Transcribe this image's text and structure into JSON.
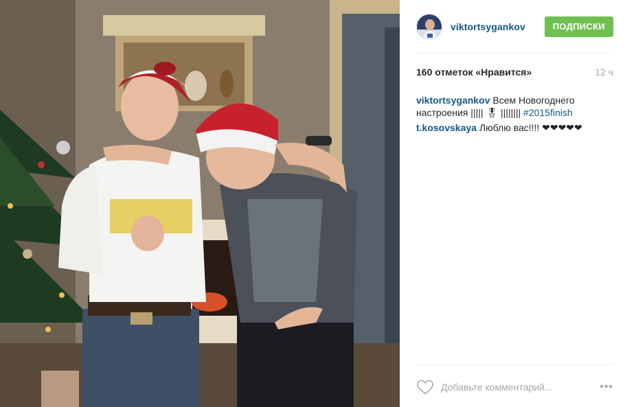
{
  "header": {
    "username": "viktortsygankov",
    "follow_label": "ПОДПИСКИ"
  },
  "meta": {
    "likes": "160 отметок «Нравится»",
    "time": "12 ч"
  },
  "comments": [
    {
      "user": "viktortsygankov",
      "text": "Всем Новогоднего настроения ||||| 🎖 |||||||| ",
      "hashtag": "#2015finish"
    },
    {
      "user": "t.kosovskaya",
      "text": "Люблю вас!!!! ❤❤❤❤❤",
      "hashtag": ""
    }
  ],
  "add_comment": {
    "placeholder": "Добавьте комментарий..."
  },
  "icons": {
    "like": "heart-icon",
    "more": "more-options-icon"
  },
  "colors": {
    "link": "#125688",
    "follow_button": "#70c050",
    "muted": "#a5a7aa"
  }
}
